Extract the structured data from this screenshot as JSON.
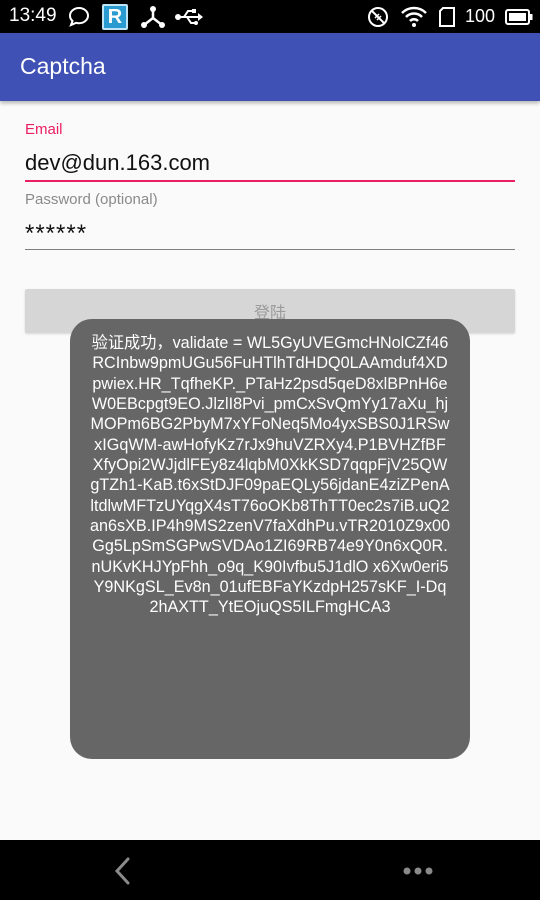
{
  "status_bar": {
    "time": "13:49",
    "battery_level": "100",
    "app_badge_letter": "R",
    "icons": [
      "chat-bubble-icon",
      "r-app-icon",
      "share-nodes-icon",
      "usb-icon",
      "no-signal-icon",
      "wifi-icon",
      "sim-card-icon",
      "battery-icon"
    ]
  },
  "app_bar": {
    "title": "Captcha",
    "color": "#3f51b5"
  },
  "form": {
    "email_label": "Email",
    "email_value": "dev@dun.163.com",
    "password_label": "Password (optional)",
    "password_value": "******",
    "login_label": "登陆",
    "accent_color": "#e91e63"
  },
  "toast": {
    "message": "验证成功，validate = WL5GyUVEGmcHNolCZf46RCInbw9pmUGu56FuHTlhTdHDQ0LAAmduf4XDpwiex.HR_TqfheKP._PTaHz2psd5qeD8xlBPnH6eW0EBcpgt9EO.JlzlI8Pvi_pmCxSvQmYy17aXu_hjMOPm6BG2PbyM7xYFoNeq5Mo4yxSBS0J1RSwxIGqWM-awHofyKz7rJx9huVZRXy4.P1BVHZfBFXfyOpi2WJjdlFEy8z4lqbM0XkKSD7qqpFjV25QWgTZh1-KaB.t6xStDJF09paEQLy56jdanE4ziZPenAltdlwMFTzUYqgX4sT76oOKb8ThTT0ec2s7iB.uQ2an6sXB.IP4h9MS2zenV7faXdhPu.vTR2010Z9x00Gg5LpSmSGPwSVDAo1ZI69RB74e9Y0n6xQ0R.nUKvKHJYpFhh_o9q_K90Ivfbu5J1dlO x6Xw0eri5Y9NKgSL_Ev8n_01ufEBFaYKzdpH257sKF_I-Dq2hAXTT_YtEOjuQS5ILFmgHCA3"
  },
  "nav_bar": {
    "buttons": [
      "back-icon",
      "more-icon"
    ]
  }
}
